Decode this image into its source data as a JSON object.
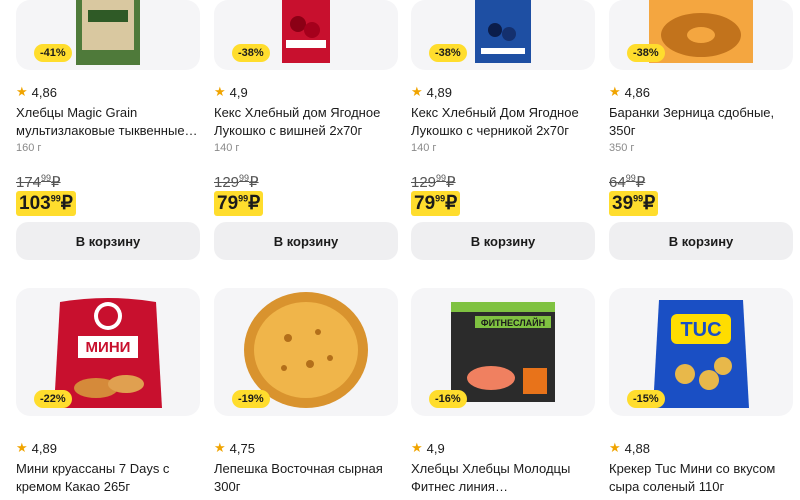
{
  "products_row1": [
    {
      "discount": "-41%",
      "rating": "4,86",
      "title": "Хлебцы Magic Grain мультизлаковые тыквенные…",
      "weight": "160 г",
      "old_price_int": "174",
      "old_price_dec": "99",
      "currency": "₽",
      "new_price_int": "103",
      "new_price_dec": "99",
      "cart_label": "В корзину"
    },
    {
      "discount": "-38%",
      "rating": "4,9",
      "title": "Кекс Хлебный дом Ягодное Лукошко с вишней 2х70г",
      "weight": "140 г",
      "old_price_int": "129",
      "old_price_dec": "99",
      "currency": "₽",
      "new_price_int": "79",
      "new_price_dec": "99",
      "cart_label": "В корзину"
    },
    {
      "discount": "-38%",
      "rating": "4,89",
      "title": "Кекс Хлебный Дом Ягодное Лукошко с черникой 2х70г",
      "weight": "140 г",
      "old_price_int": "129",
      "old_price_dec": "99",
      "currency": "₽",
      "new_price_int": "79",
      "new_price_dec": "99",
      "cart_label": "В корзину"
    },
    {
      "discount": "-38%",
      "rating": "4,86",
      "title": "Баранки Зерница сдобные, 350г",
      "weight": "350 г",
      "old_price_int": "64",
      "old_price_dec": "99",
      "currency": "₽",
      "new_price_int": "39",
      "new_price_dec": "99",
      "cart_label": "В корзину"
    }
  ],
  "products_row2": [
    {
      "discount": "-22%",
      "rating": "4,89",
      "title": "Мини круассаны 7 Days с кремом Какао 265г",
      "package_text": "МИНИ"
    },
    {
      "discount": "-19%",
      "rating": "4,75",
      "title": "Лепешка Восточная сырная 300г"
    },
    {
      "discount": "-16%",
      "rating": "4,9",
      "title": "Хлебцы Хлебцы Молодцы Фитнес линия…",
      "package_text": "ФИТНЕСЛАЙН"
    },
    {
      "discount": "-15%",
      "rating": "4,88",
      "title": "Крекер Tuc Мини со вкусом сыра соленый 110г",
      "package_text": "TUC"
    }
  ],
  "colors": {
    "accent": "#ffdd2d",
    "star": "#f0a400",
    "button_bg": "#efeff1"
  }
}
